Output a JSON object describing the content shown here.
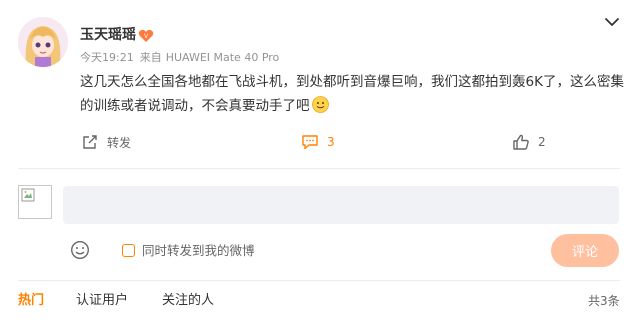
{
  "post": {
    "username": "玉天瑶瑶",
    "time": "今天19:21",
    "source_label": "来自",
    "device": "HUAWEI Mate 40 Pro",
    "content": "这几天怎么全国各地都在飞战斗机，到处都听到音爆巨响，我们这都拍到轰6K了，这么密集的训练或者说调动，不会真要动手了吧",
    "emoji": "smile-emoji",
    "more_icon": "chevron-down-icon",
    "badge_icon": "vip-heart-badge-icon"
  },
  "actions": {
    "repost_label": "转发",
    "comment_count": "3",
    "like_count": "2"
  },
  "reply": {
    "input_value": "",
    "sync_label": "同时转发到我的微博",
    "submit_label": "评论"
  },
  "tabs": [
    "热门",
    "认证用户",
    "关注的人"
  ],
  "total": "共3条",
  "colors": {
    "accent": "#ff8200",
    "submit_bg": "#ffc09f",
    "input_bg": "#f1f2f5"
  }
}
